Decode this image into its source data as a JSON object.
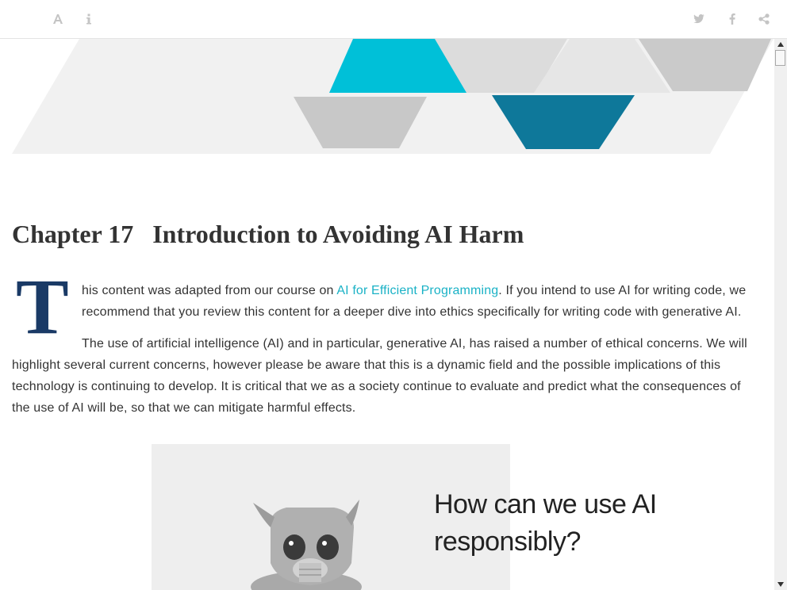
{
  "toolbar": {
    "left_icons": [
      "font-settings-icon",
      "info-icon"
    ],
    "right_icons": [
      "twitter-icon",
      "facebook-icon",
      "share-icon"
    ]
  },
  "chapter": {
    "number": "Chapter 17",
    "title": "Introduction to Avoiding AI Harm"
  },
  "intro": {
    "dropcap": "T",
    "text_before_link": "his content was adapted from our course on ",
    "link_text": "AI for Efficient Programming",
    "text_after_link": ". If you intend to use AI for writing code, we recommend that you review this content for a deeper dive into ethics specifically for writing code with generative AI."
  },
  "paragraph2": "The use of artificial intelligence (AI) and in particular, generative AI, has raised a number of ethical concerns. We will highlight several current concerns, however please be aware that this is a dynamic field and the possible implications of this technology is continuing to develop. It is critical that we as a society continue to evaluate and predict what the consequences of the use of AI will be, so that we can mitigate harmful effects.",
  "figure": {
    "caption_text": "How can we use AI responsibly?"
  },
  "colors": {
    "cyan": "#00c0d8",
    "teal": "#0e789a",
    "grey": "#c8c8c8",
    "light_grey": "#dcdcdc",
    "dropcap": "#1a3a66",
    "link": "#1ab2c6"
  }
}
